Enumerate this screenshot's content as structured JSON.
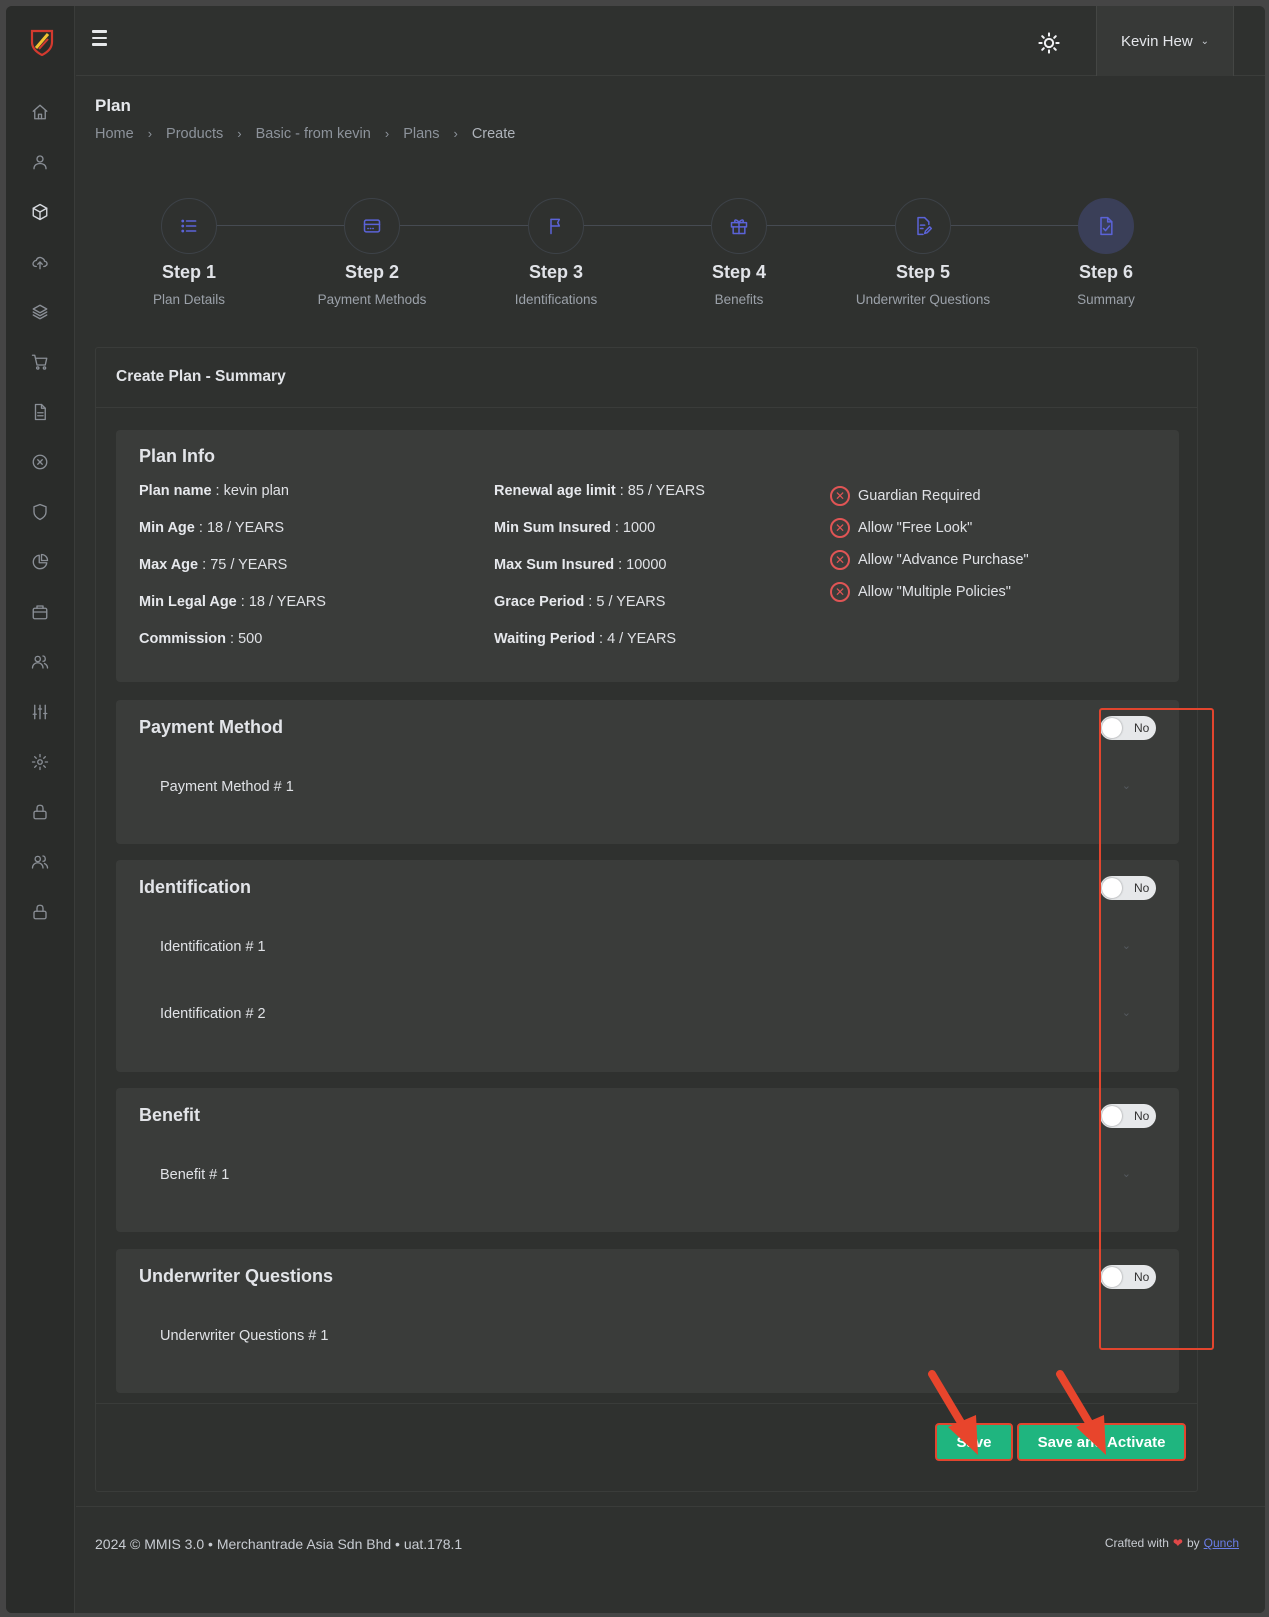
{
  "user": {
    "name": "Kevin Hew"
  },
  "page": {
    "title": "Plan"
  },
  "breadcrumb": [
    "Home",
    "Products",
    "Basic - from kevin",
    "Plans",
    "Create"
  ],
  "steps": [
    {
      "title": "Step 1",
      "subtitle": "Plan Details",
      "icon": "list-icon"
    },
    {
      "title": "Step 2",
      "subtitle": "Payment Methods",
      "icon": "credit-card-icon"
    },
    {
      "title": "Step 3",
      "subtitle": "Identifications",
      "icon": "flag-icon"
    },
    {
      "title": "Step 4",
      "subtitle": "Benefits",
      "icon": "gift-icon"
    },
    {
      "title": "Step 5",
      "subtitle": "Underwriter Questions",
      "icon": "edit-document-icon"
    },
    {
      "title": "Step 6",
      "subtitle": "Summary",
      "icon": "document-check-icon"
    }
  ],
  "active_step": 6,
  "card": {
    "title": "Create Plan - Summary"
  },
  "plan_info": {
    "title": "Plan Info",
    "fields": [
      {
        "label": "Plan name",
        "value": "kevin plan"
      },
      {
        "label": "Min Age",
        "value": "18 / YEARS"
      },
      {
        "label": "Max Age",
        "value": "75 / YEARS"
      },
      {
        "label": "Min Legal Age",
        "value": "18 / YEARS"
      },
      {
        "label": "Commission",
        "value": "500"
      },
      {
        "label": "Renewal age limit",
        "value": "85 / YEARS"
      },
      {
        "label": "Min Sum Insured",
        "value": "1000"
      },
      {
        "label": "Max Sum Insured",
        "value": "10000"
      },
      {
        "label": "Grace Period",
        "value": "5 / YEARS"
      },
      {
        "label": "Waiting Period",
        "value": "4 / YEARS"
      }
    ],
    "flags": [
      "Guardian Required",
      "Allow \"Free Look\"",
      "Allow \"Advance Purchase\"",
      "Allow \"Multiple Policies\""
    ]
  },
  "sections": [
    {
      "title": "Payment Method",
      "toggle": "No",
      "items": [
        "Payment Method # 1"
      ]
    },
    {
      "title": "Identification",
      "toggle": "No",
      "items": [
        "Identification # 1",
        "Identification # 2"
      ]
    },
    {
      "title": "Benefit",
      "toggle": "No",
      "items": [
        "Benefit # 1"
      ]
    },
    {
      "title": "Underwriter Questions",
      "toggle": "No",
      "items": [
        "Underwriter Questions # 1"
      ]
    }
  ],
  "buttons": {
    "save": "Save",
    "save_activate": "Save and Activate"
  },
  "footer": {
    "left": "2024 © MMIS 3.0 • Merchantrade Asia Sdn Bhd • uat.178.1",
    "crafted": "Crafted with",
    "by": "by",
    "brand": "Qunch"
  },
  "colors": {
    "accent": "#5b63d8",
    "primary_button": "#1fb57f",
    "annotation": "#e2452e",
    "error": "#e05555"
  }
}
